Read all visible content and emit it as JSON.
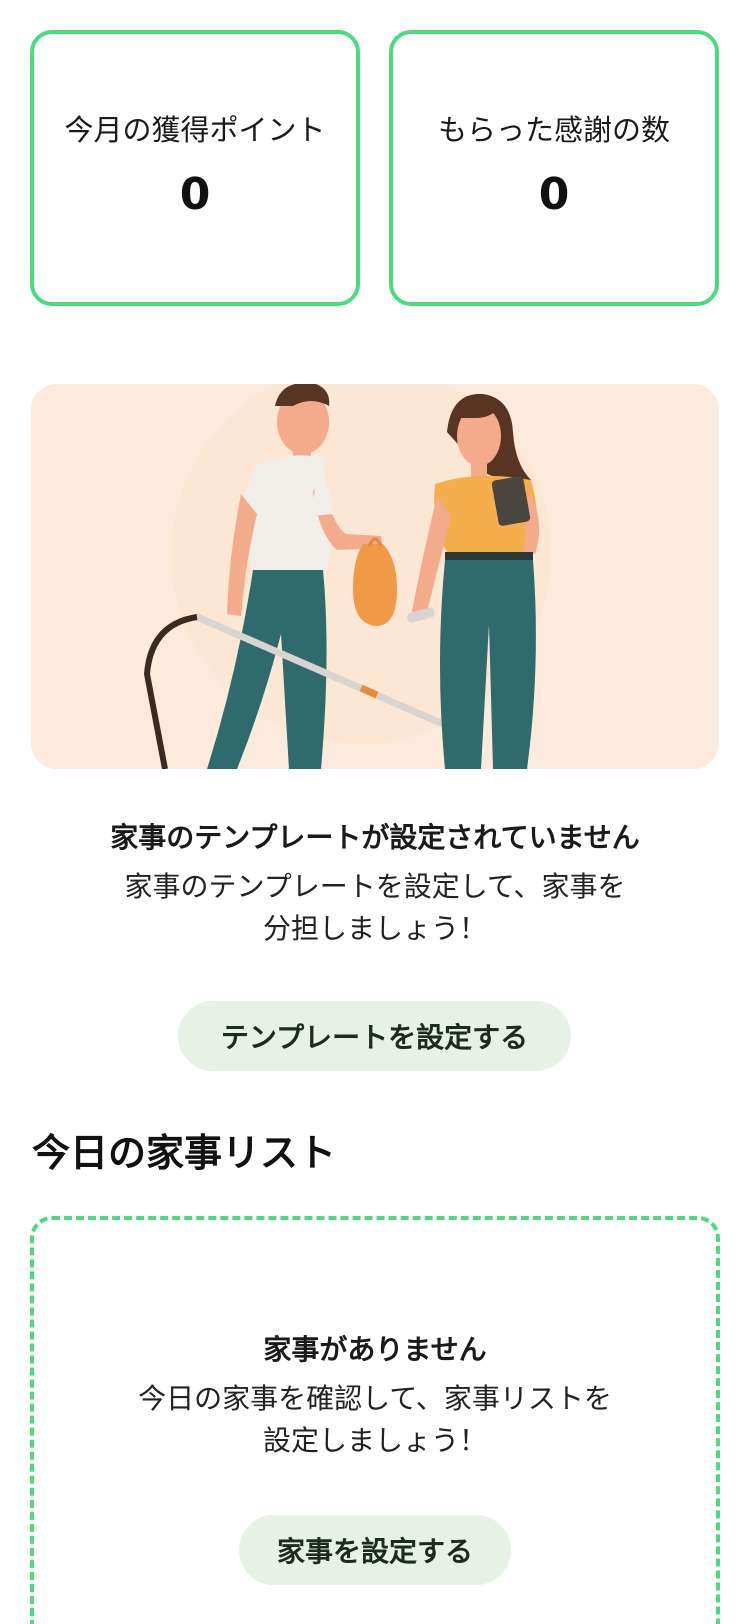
{
  "stats": [
    {
      "label": "今月の獲得ポイント",
      "value": "0"
    },
    {
      "label": "もらった感謝の数",
      "value": "0"
    }
  ],
  "template_empty": {
    "title": "家事のテンプレートが設定されていません",
    "desc_line1": "家事のテンプレートを設定して、家事を",
    "desc_line2": "分担しましょう！",
    "button_label": "テンプレートを設定する"
  },
  "today": {
    "section_title": "今日の家事リスト",
    "empty_title": "家事がありません",
    "desc_line1": "今日の家事を確認して、家事リストを",
    "desc_line2": "設定しましょう！",
    "button_label": "家事を設定する"
  },
  "colors": {
    "accent_green": "#4cdb7c",
    "pill_bg": "#e7f1e6",
    "illustration_bg": "#fcebdc"
  }
}
